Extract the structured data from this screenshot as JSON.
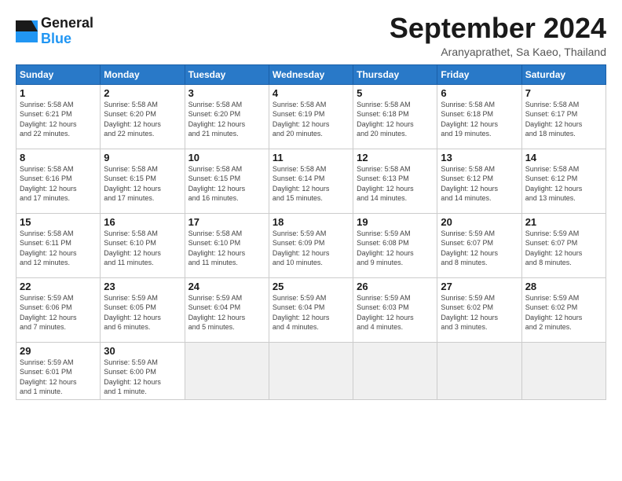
{
  "header": {
    "logo_general": "General",
    "logo_blue": "Blue",
    "month_title": "September 2024",
    "location": "Aranyaprathet, Sa Kaeo, Thailand"
  },
  "days_of_week": [
    "Sunday",
    "Monday",
    "Tuesday",
    "Wednesday",
    "Thursday",
    "Friday",
    "Saturday"
  ],
  "weeks": [
    [
      {
        "num": "1",
        "info": "Sunrise: 5:58 AM\nSunset: 6:21 PM\nDaylight: 12 hours\nand 22 minutes."
      },
      {
        "num": "2",
        "info": "Sunrise: 5:58 AM\nSunset: 6:20 PM\nDaylight: 12 hours\nand 22 minutes."
      },
      {
        "num": "3",
        "info": "Sunrise: 5:58 AM\nSunset: 6:20 PM\nDaylight: 12 hours\nand 21 minutes."
      },
      {
        "num": "4",
        "info": "Sunrise: 5:58 AM\nSunset: 6:19 PM\nDaylight: 12 hours\nand 20 minutes."
      },
      {
        "num": "5",
        "info": "Sunrise: 5:58 AM\nSunset: 6:18 PM\nDaylight: 12 hours\nand 20 minutes."
      },
      {
        "num": "6",
        "info": "Sunrise: 5:58 AM\nSunset: 6:18 PM\nDaylight: 12 hours\nand 19 minutes."
      },
      {
        "num": "7",
        "info": "Sunrise: 5:58 AM\nSunset: 6:17 PM\nDaylight: 12 hours\nand 18 minutes."
      }
    ],
    [
      {
        "num": "8",
        "info": "Sunrise: 5:58 AM\nSunset: 6:16 PM\nDaylight: 12 hours\nand 17 minutes."
      },
      {
        "num": "9",
        "info": "Sunrise: 5:58 AM\nSunset: 6:15 PM\nDaylight: 12 hours\nand 17 minutes."
      },
      {
        "num": "10",
        "info": "Sunrise: 5:58 AM\nSunset: 6:15 PM\nDaylight: 12 hours\nand 16 minutes."
      },
      {
        "num": "11",
        "info": "Sunrise: 5:58 AM\nSunset: 6:14 PM\nDaylight: 12 hours\nand 15 minutes."
      },
      {
        "num": "12",
        "info": "Sunrise: 5:58 AM\nSunset: 6:13 PM\nDaylight: 12 hours\nand 14 minutes."
      },
      {
        "num": "13",
        "info": "Sunrise: 5:58 AM\nSunset: 6:12 PM\nDaylight: 12 hours\nand 14 minutes."
      },
      {
        "num": "14",
        "info": "Sunrise: 5:58 AM\nSunset: 6:12 PM\nDaylight: 12 hours\nand 13 minutes."
      }
    ],
    [
      {
        "num": "15",
        "info": "Sunrise: 5:58 AM\nSunset: 6:11 PM\nDaylight: 12 hours\nand 12 minutes."
      },
      {
        "num": "16",
        "info": "Sunrise: 5:58 AM\nSunset: 6:10 PM\nDaylight: 12 hours\nand 11 minutes."
      },
      {
        "num": "17",
        "info": "Sunrise: 5:58 AM\nSunset: 6:10 PM\nDaylight: 12 hours\nand 11 minutes."
      },
      {
        "num": "18",
        "info": "Sunrise: 5:59 AM\nSunset: 6:09 PM\nDaylight: 12 hours\nand 10 minutes."
      },
      {
        "num": "19",
        "info": "Sunrise: 5:59 AM\nSunset: 6:08 PM\nDaylight: 12 hours\nand 9 minutes."
      },
      {
        "num": "20",
        "info": "Sunrise: 5:59 AM\nSunset: 6:07 PM\nDaylight: 12 hours\nand 8 minutes."
      },
      {
        "num": "21",
        "info": "Sunrise: 5:59 AM\nSunset: 6:07 PM\nDaylight: 12 hours\nand 8 minutes."
      }
    ],
    [
      {
        "num": "22",
        "info": "Sunrise: 5:59 AM\nSunset: 6:06 PM\nDaylight: 12 hours\nand 7 minutes."
      },
      {
        "num": "23",
        "info": "Sunrise: 5:59 AM\nSunset: 6:05 PM\nDaylight: 12 hours\nand 6 minutes."
      },
      {
        "num": "24",
        "info": "Sunrise: 5:59 AM\nSunset: 6:04 PM\nDaylight: 12 hours\nand 5 minutes."
      },
      {
        "num": "25",
        "info": "Sunrise: 5:59 AM\nSunset: 6:04 PM\nDaylight: 12 hours\nand 4 minutes."
      },
      {
        "num": "26",
        "info": "Sunrise: 5:59 AM\nSunset: 6:03 PM\nDaylight: 12 hours\nand 4 minutes."
      },
      {
        "num": "27",
        "info": "Sunrise: 5:59 AM\nSunset: 6:02 PM\nDaylight: 12 hours\nand 3 minutes."
      },
      {
        "num": "28",
        "info": "Sunrise: 5:59 AM\nSunset: 6:02 PM\nDaylight: 12 hours\nand 2 minutes."
      }
    ],
    [
      {
        "num": "29",
        "info": "Sunrise: 5:59 AM\nSunset: 6:01 PM\nDaylight: 12 hours\nand 1 minute."
      },
      {
        "num": "30",
        "info": "Sunrise: 5:59 AM\nSunset: 6:00 PM\nDaylight: 12 hours\nand 1 minute."
      },
      {
        "num": "",
        "info": ""
      },
      {
        "num": "",
        "info": ""
      },
      {
        "num": "",
        "info": ""
      },
      {
        "num": "",
        "info": ""
      },
      {
        "num": "",
        "info": ""
      }
    ]
  ]
}
